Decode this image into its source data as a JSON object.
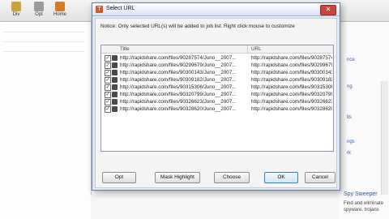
{
  "toolbar": {
    "buttons": [
      {
        "label": "Div",
        "icon": "div-icon",
        "color": "#c9a23a"
      },
      {
        "label": "Opt",
        "icon": "options-icon",
        "color": "#9a9a9a"
      },
      {
        "label": "Home",
        "icon": "home-icon",
        "color": "#d47a2a"
      }
    ]
  },
  "sidebar": {
    "links": [
      "nce",
      "ng",
      "lts",
      "ngs",
      "rk"
    ],
    "ad": {
      "title": "Spy Sweeper",
      "lines": [
        "Find and eliminate",
        "spyware, trojans"
      ]
    }
  },
  "dialog": {
    "title": "Select URL",
    "app_icon_letter": "T",
    "close_label": "✕",
    "notice": "Notice: Only selected URL(s) will be added to job list. Right click mouse to customize",
    "columns": {
      "title": "Title",
      "url": "URL"
    },
    "rows": [
      {
        "checked": true,
        "title": "http://rapidshare.com/files/90287574/Juno__2007...",
        "url": "http://rapidshare.com/files/90287574/Juno_"
      },
      {
        "checked": true,
        "title": "http://rapidshare.com/files/90299679/Juno__2007...",
        "url": "http://rapidshare.com/files/90299679/Juno_"
      },
      {
        "checked": true,
        "title": "http://rapidshare.com/files/90300143/Juno__2007...",
        "url": "http://rapidshare.com/files/90300143/Juno_"
      },
      {
        "checked": true,
        "title": "http://rapidshare.com/files/90309182/Juno__2007...",
        "url": "http://rapidshare.com/files/90309182/Juno_"
      },
      {
        "checked": true,
        "title": "http://rapidshare.com/files/90315306/Juno__2007...",
        "url": "http://rapidshare.com/files/90315306/Juno_"
      },
      {
        "checked": true,
        "title": "http://rapidshare.com/files/90320799/Juno__2007...",
        "url": "http://rapidshare.com/files/90320799/Juno_"
      },
      {
        "checked": true,
        "title": "http://rapidshare.com/files/90326623/Juno__2007...",
        "url": "http://rapidshare.com/files/90326623/Juno_"
      },
      {
        "checked": true,
        "title": "http://rapidshare.com/files/90328620/Juno__2007...",
        "url": "http://rapidshare.com/files/90328620/Juno_"
      }
    ],
    "buttons": {
      "opt": "Opt",
      "mask": "Mask Highlight",
      "choose": "Choose",
      "ok": "OK",
      "cancel": "Cancel"
    }
  }
}
